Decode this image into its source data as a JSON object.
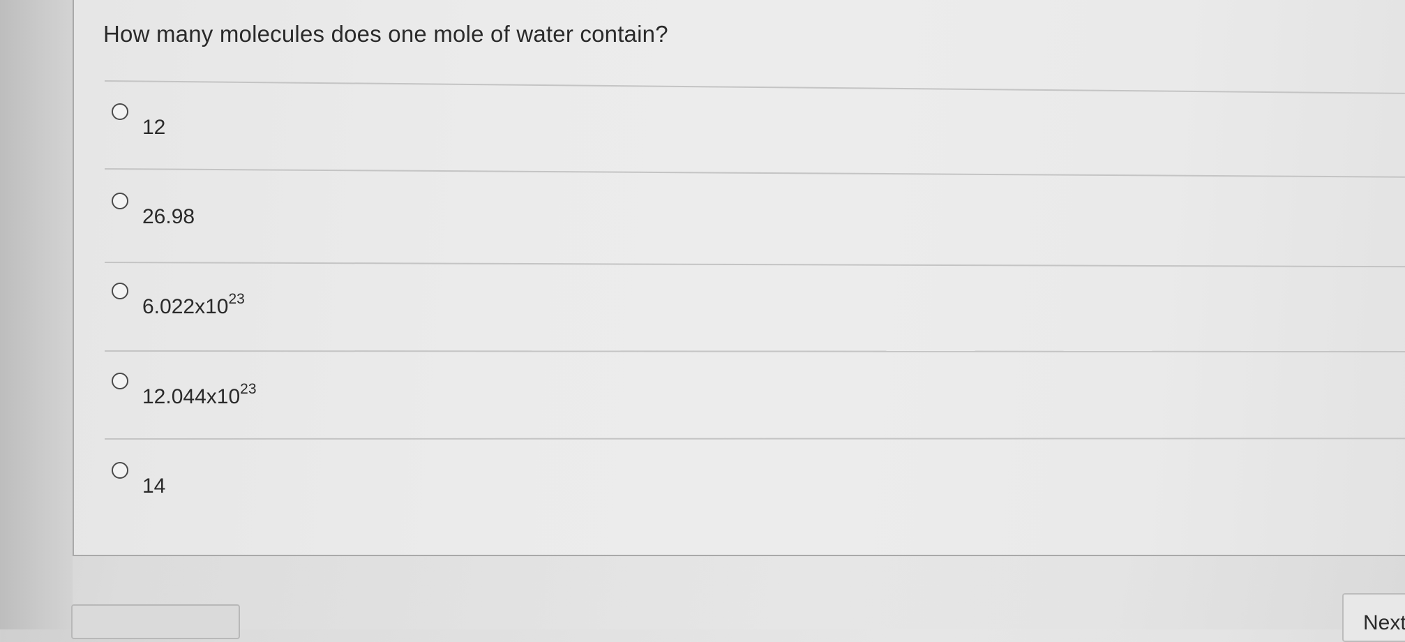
{
  "question": {
    "text": "How many molecules does one mole of water contain?"
  },
  "options": [
    {
      "base": "12",
      "exponent": "",
      "selected": false
    },
    {
      "base": "26.98",
      "exponent": "",
      "selected": false
    },
    {
      "base": "6.022x10",
      "exponent": "23",
      "selected": false
    },
    {
      "base": "12.044x10",
      "exponent": "23",
      "selected": false
    },
    {
      "base": "14",
      "exponent": "",
      "selected": false
    }
  ],
  "navigation": {
    "previous_label": "",
    "next_label": "Next"
  }
}
